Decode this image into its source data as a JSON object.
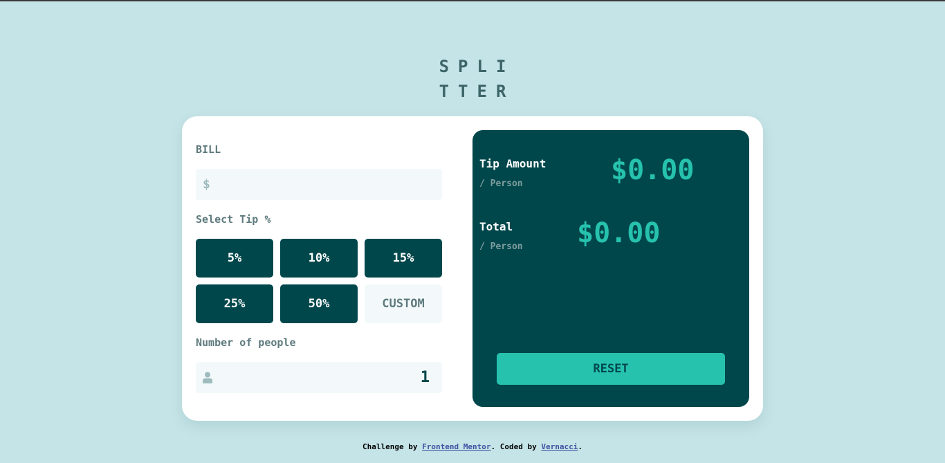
{
  "logo": {
    "line1": "SPLI",
    "line2": "TTER"
  },
  "bill": {
    "label": "BILL",
    "prefix": "$",
    "value": ""
  },
  "tip": {
    "label": "Select Tip %",
    "options": [
      "5%",
      "10%",
      "15%",
      "25%",
      "50%"
    ],
    "custom_label": "CUSTOM"
  },
  "people": {
    "label": "Number of people",
    "value": "1"
  },
  "results": {
    "tip_title": "Tip Amount",
    "tip_sub": "/ Person",
    "tip_amount": "$0.00",
    "total_title": "Total",
    "total_sub": "/ Person",
    "total_amount": "$0.00",
    "reset_label": "RESET"
  },
  "footer": {
    "prefix": "Challenge by ",
    "link1": "Frontend Mentor",
    "middle": ". Coded by ",
    "link2": "Vernacci",
    "suffix": "."
  },
  "colors": {
    "background": "#c5e4e7",
    "dark_teal": "#00474b",
    "accent": "#26c2ae",
    "input_bg": "#f3f9fa"
  },
  "icons": {
    "person": "person-icon"
  }
}
